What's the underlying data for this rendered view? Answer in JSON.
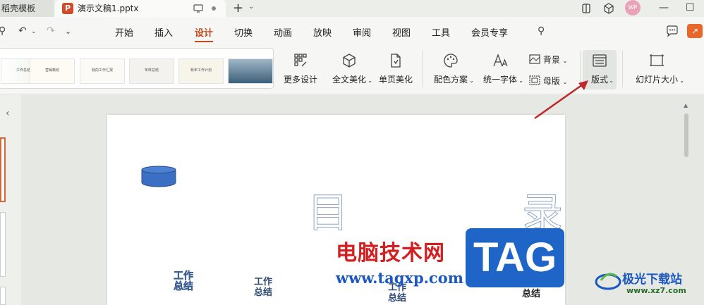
{
  "titlebar": {
    "inactive_tab": "稻壳模板",
    "active_tab": "演示文稿1.pptx",
    "avatar_text": "WP"
  },
  "menu": {
    "items": [
      "开始",
      "插入",
      "设计",
      "切换",
      "动画",
      "放映",
      "审阅",
      "视图",
      "工具",
      "会员专享"
    ],
    "active": "设计"
  },
  "ribbon": {
    "more_design": "更多设计",
    "beautify_all": "全文美化",
    "beautify_page": "单页美化",
    "color_scheme": "配色方案",
    "unify_font": "统一字体",
    "background": "背景",
    "master": "母版",
    "layout": "版式",
    "slide_size": "幻灯片大小",
    "gallery_thumbs": [
      "工作总结",
      "营销策划",
      "我的工作汇报",
      "年终总结",
      "新年工作计划"
    ]
  },
  "slide": {
    "char_mu": "目",
    "char_lu": "录",
    "work_labels": [
      {
        "l1": "工作",
        "l2": "总结"
      },
      {
        "l1": "工作",
        "l2": "总结"
      },
      {
        "l1": "工作",
        "l2": "总结"
      },
      {
        "l1": "工作",
        "l2": "总结"
      }
    ]
  },
  "watermark": {
    "site_cn": "电脑技术网",
    "site_url": "www.tagxp.com",
    "tag": "TAG",
    "jg_name": "极光下载站",
    "jg_url": "www.xz7.com"
  },
  "colors": {
    "accent": "#c24b1f",
    "annotation_arrow": "#c0282a",
    "shape_fill": "#3a6fc4"
  }
}
